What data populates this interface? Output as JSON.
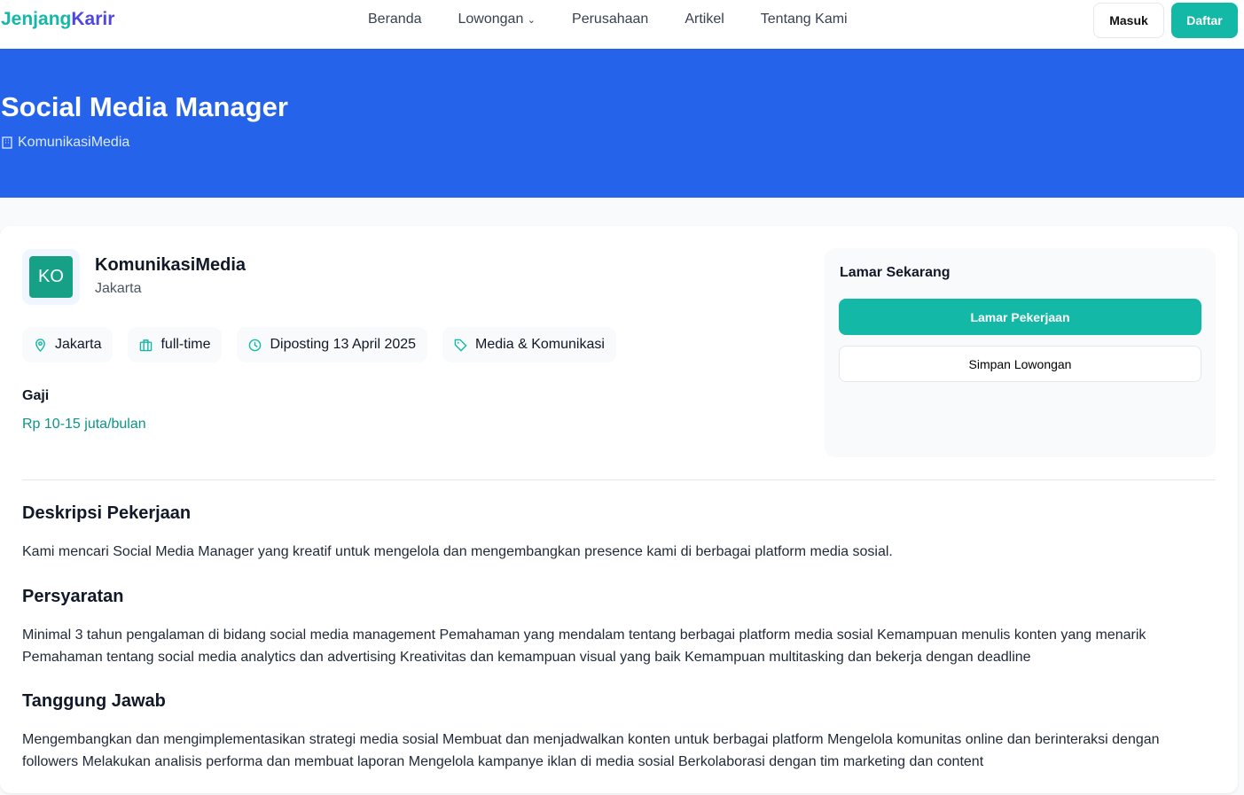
{
  "nav": {
    "logo_a": "Jenjang",
    "logo_b": "Karir",
    "links": [
      "Beranda",
      "Lowongan",
      "Perusahaan",
      "Artikel",
      "Tentang Kami"
    ],
    "masuk": "Masuk",
    "daftar": "Daftar"
  },
  "hero": {
    "title": "Social Media Manager",
    "company": "KomunikasiMedia"
  },
  "company": {
    "initials": "KO",
    "name": "KomunikasiMedia",
    "location": "Jakarta"
  },
  "chips": [
    "Jakarta",
    "full-time",
    "Diposting 13 April 2025",
    "Media & Komunikasi"
  ],
  "salary": {
    "label": "Gaji",
    "value": "Rp 10-15 juta/bulan"
  },
  "apply": {
    "title": "Lamar Sekarang",
    "apply": "Lamar Pekerjaan",
    "save": "Simpan Lowongan"
  },
  "sections": [
    {
      "title": "Deskripsi Pekerjaan",
      "body": "Kami mencari Social Media Manager yang kreatif untuk mengelola dan mengembangkan presence kami di berbagai platform media sosial."
    },
    {
      "title": "Persyaratan",
      "body": "Minimal 3 tahun pengalaman di bidang social media management Pemahaman yang mendalam tentang berbagai platform media sosial Kemampuan menulis konten yang menarik Pemahaman tentang social media analytics dan advertising Kreativitas dan kemampuan visual yang baik Kemampuan multitasking dan bekerja dengan deadline"
    },
    {
      "title": "Tanggung Jawab",
      "body": "Mengembangkan dan mengimplementasikan strategi media sosial Membuat dan menjadwalkan konten untuk berbagai platform Mengelola komunitas online dan berinteraksi dengan followers Melakukan analisis performa dan membuat laporan Mengelola kampanye iklan di media sosial Berkolaborasi dengan tim marketing dan content"
    }
  ]
}
